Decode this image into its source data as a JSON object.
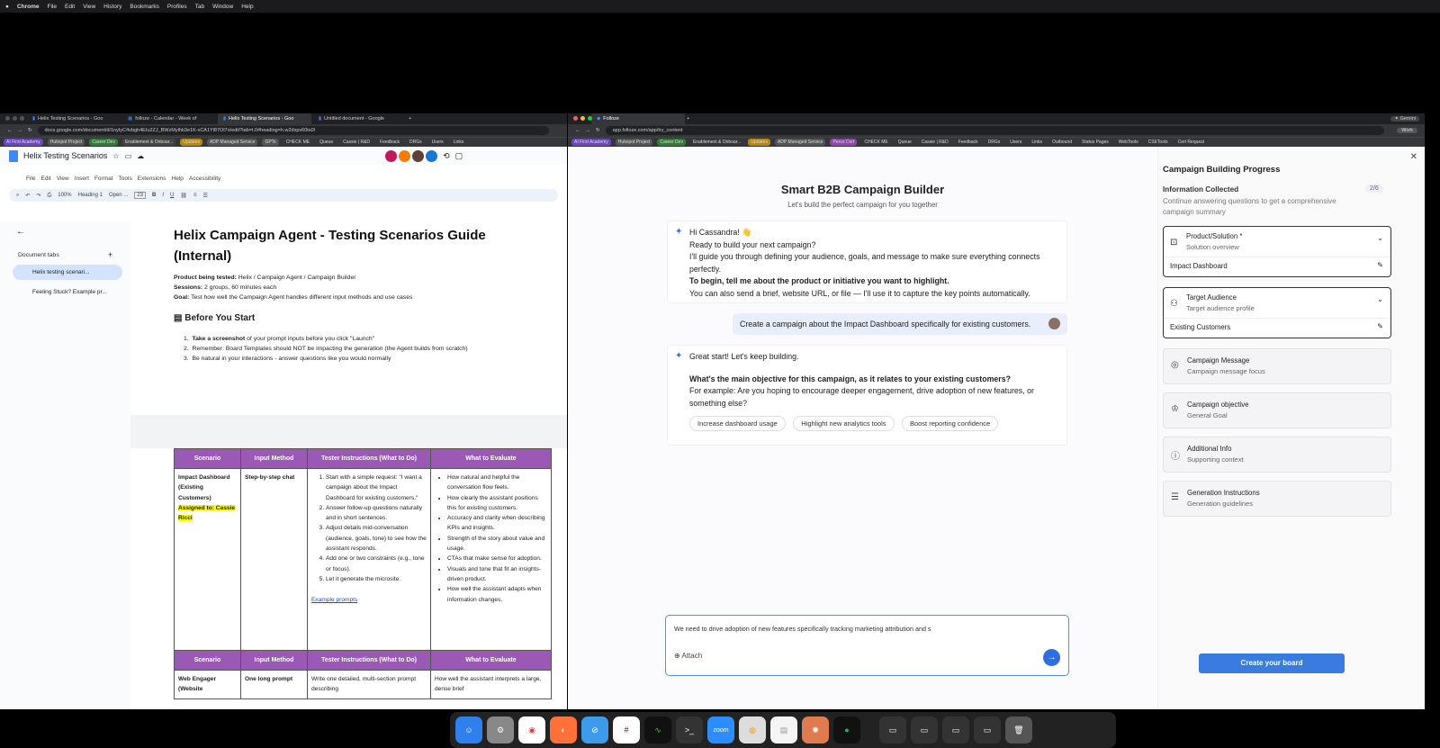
{
  "menubar": {
    "app": "Chrome",
    "items": [
      "File",
      "Edit",
      "View",
      "History",
      "Bookmarks",
      "Profiles",
      "Tab",
      "Window",
      "Help"
    ]
  },
  "left_tabs": [
    "Helix Testing Scenarios - Goo",
    "folloze - Calendar - Week of",
    "Helix Testing Scenarios - Goo",
    "Untitled document - Google"
  ],
  "left_url": "docs.google.com/document/d/1nyIyC4vbgh4EIu2ZJ_BWzMylhb3e1K-xCA1Yl87Ol7o/edit?tab=t.0#heading=h.w2dspv60ts0l",
  "bookmarks_left": [
    "AI First Academy",
    "Hubspot Project",
    "Career Dev",
    "Enablement & Onboar...",
    "Updates",
    "ADP Managed Service",
    "GPTs",
    "CHECK ME",
    "Queue",
    "Cassie | R&D",
    "Feedback",
    "DRGs",
    "Users",
    "Links"
  ],
  "docs": {
    "title": "Helix Testing Scenarios",
    "menus": [
      "File",
      "Edit",
      "View",
      "Insert",
      "Format",
      "Tools",
      "Extensions",
      "Help",
      "Accessibility"
    ],
    "zoom": "100%",
    "style": "Heading 1",
    "font": "Open ...",
    "fontsize": "23",
    "tabs_header": "Document tabs",
    "tab_items": [
      "Helix testing scenari...",
      "Feeling Stuck? Example pr..."
    ],
    "heading": "Helix Campaign Agent - Testing Scenarios Guide (Internal)",
    "product_label": "Product being tested:",
    "product_value": " Helix / Campaign Agent / Campaign Builder",
    "sessions_label": "Sessions:",
    "sessions_value": " 2 groups, 60 minutes each",
    "goal_label": "Goal:",
    "goal_value": " Test how well the Campaign Agent handles different input methods and use cases",
    "before_heading": "Before You Start",
    "before_1_bold": "Take a screenshot",
    "before_1_rest": " of your prompt inputs before you click \"Launch\"",
    "before_2": "Remember: Board Templates should NOT be impacting the generation (the Agent builds from scratch)",
    "before_3": "Be natural in your interactions - answer questions like you would normally",
    "table_headers": [
      "Scenario",
      "Input Method",
      "Tester Instructions (What to Do)",
      "What to Evaluate"
    ],
    "row1_scenario": "Impact Dashboard (Existing Customers)",
    "row1_assigned": "Assigned to: Cassie Ricci",
    "row1_method": "Step-by-step chat",
    "row1_instructions": [
      "Start with a simple request: \"I want a campaign about the Impact Dashboard for existing customers.\"",
      "Answer follow-up questions naturally and in short sentences.",
      "Adjust details mid-conversation (audience, goals, tone) to see how the assistant responds.",
      "Add one or two constraints (e.g., tone or focus).",
      "Let it generate the microsite."
    ],
    "row1_link": "Example prompts",
    "row1_evaluate": [
      "How natural and helpful the conversation flow feels.",
      "How clearly the assistant positions this for existing customers.",
      "Accuracy and clarity when describing KPIs and insights.",
      "Strength of the story about value and usage.",
      "CTAs that make sense for adoption.",
      "Visuals and tone that fit an insights-driven product.",
      "How well the assistant adapts when information changes."
    ],
    "row2_scenario": "Web Engager (Website",
    "row2_method": "One long prompt",
    "row2_instruction": "Write one detailed, multi-section prompt describing",
    "row2_evaluate": "How well the assistant interprets a large, dense brief"
  },
  "right_tab": "Folloze",
  "right_url": "app.folloze.com/app/try_content",
  "bookmarks_right": [
    "AI First Academy",
    "Hubspot Project",
    "Career Dev",
    "Enablement & Onboar...",
    "Updates",
    "ADP Managed Service",
    "Perso Cert",
    "CHECK ME",
    "Queue",
    "Cassie | R&D",
    "Feedback",
    "DRGs",
    "Users",
    "Links",
    "Outbound",
    "Status Pages",
    "WebTools",
    "CSETools",
    "Cert Request"
  ],
  "profile": "Work",
  "gemini": "Gemini",
  "chat": {
    "title": "Smart B2B Campaign Builder",
    "subtitle": "Let's build the perfect campaign for you together",
    "m1_greet": "Hi Cassandra! 👋",
    "m1_l1": "Ready to build your next campaign?",
    "m1_l2": "I'll guide you through defining your audience, goals, and message to make sure everything connects perfectly.",
    "m1_bold": "To begin, tell me about the product or initiative you want to highlight.",
    "m1_l3": "You can also send a brief, website URL, or file — I'll use it to capture the key points automatically.",
    "user_msg": "Create a campaign about the Impact Dashboard specifically for existing customers.",
    "m2_l1": "Great start! Let's keep building.",
    "m2_bold": "What's the main objective for this campaign, as it relates to your existing customers?",
    "m2_l2": "For example: Are you hoping to encourage deeper engagement, drive adoption of new features, or something else?",
    "chips": [
      "Increase dashboard usage",
      "Highlight new analytics tools",
      "Boost reporting confidence"
    ],
    "input_value": "We need to drive adoption of new features specifically tracking marketing attribution and s",
    "attach": "Attach"
  },
  "progress": {
    "title": "Campaign Building Progress",
    "info": "Information Collected",
    "count": "2/6",
    "desc": "Continue answering questions to get a comprehensive campaign summary",
    "product_title": "Product/Solution *",
    "product_sub": "Solution overview",
    "product_value": "Impact Dashboard",
    "audience_title": "Target Audience",
    "audience_sub": "Target audience profile",
    "audience_value": "Existing Customers",
    "items": [
      {
        "title": "Campaign Message",
        "sub": "Campaign message focus"
      },
      {
        "title": "Campaign objective",
        "sub": "General Goal"
      },
      {
        "title": "Additional Info",
        "sub": "Supporting context"
      },
      {
        "title": "Generation Instructions",
        "sub": "Generation guidelines"
      }
    ],
    "button": "Create your board"
  },
  "dock_apps": [
    "finder-icon",
    "settings-icon",
    "chrome-icon",
    "firefox-icon",
    "safari-icon",
    "slack-icon",
    "activity-icon",
    "terminal-icon",
    "zoom-icon",
    "podcast-icon",
    "notes-icon",
    "claude-icon",
    "spotify-icon"
  ],
  "zoom_label": "zoom"
}
